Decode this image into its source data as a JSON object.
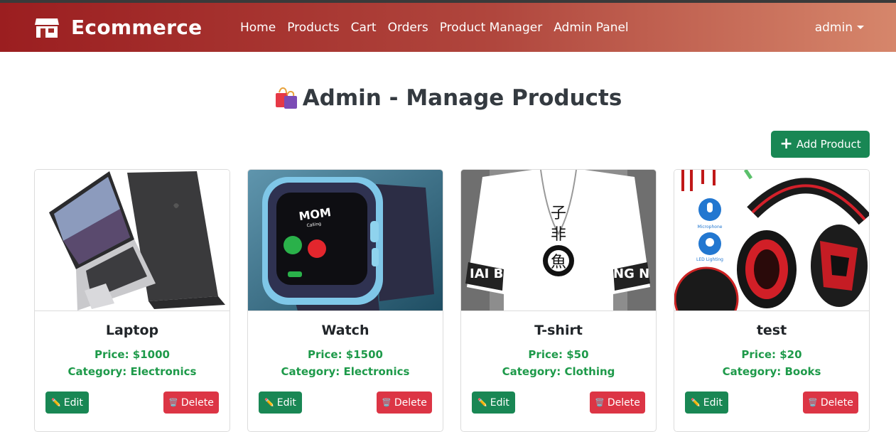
{
  "navbar": {
    "brand": "Ecommerce",
    "brand_icon": "store-icon",
    "links": [
      "Home",
      "Products",
      "Cart",
      "Orders",
      "Product Manager",
      "Admin Panel"
    ],
    "user": "admin"
  },
  "page": {
    "title": "Admin - Manage Products",
    "title_icon": "shopping-bags-icon",
    "add_button": "Add Product",
    "add_icon": "plus-icon"
  },
  "products": [
    {
      "name": "Laptop",
      "price": "Price: $1000",
      "category": "Category: Electronics",
      "image": "laptop-image",
      "edit": "Edit",
      "delete": "Delete"
    },
    {
      "name": "Watch",
      "price": "Price: $1500",
      "category": "Category: Electronics",
      "image": "smartwatch-image",
      "edit": "Edit",
      "delete": "Delete"
    },
    {
      "name": "T-shirt",
      "price": "Price: $50",
      "category": "Category: Clothing",
      "image": "tshirt-image",
      "edit": "Edit",
      "delete": "Delete"
    },
    {
      "name": "test",
      "price": "Price: $20",
      "category": "Category: Books",
      "image": "headphones-image",
      "edit": "Edit",
      "delete": "Delete"
    }
  ],
  "image_text": {
    "watch_caller": "MOM",
    "watch_status": "Calling",
    "shirt_char_1": "子",
    "shirt_char_2": "非",
    "shirt_char_3": "魚",
    "shirt_left": "IAI B",
    "shirt_right": "NG N",
    "mic_label": "Microphone",
    "led_label": "LED Lighting"
  },
  "colors": {
    "navbar_start": "#9b1e20",
    "navbar_end": "#d6866b",
    "success": "#198754",
    "danger": "#dc3545",
    "price_text": "#1e9a4a"
  }
}
